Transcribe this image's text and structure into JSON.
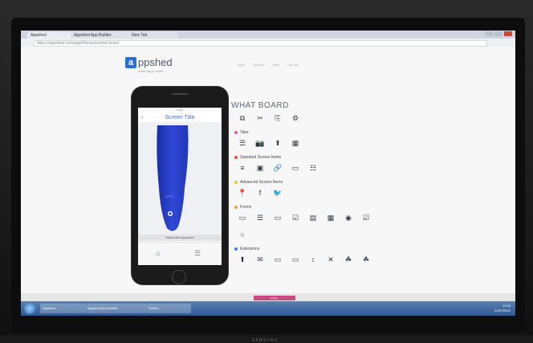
{
  "browser": {
    "tabs": [
      "Appshed",
      "Appshed App Builder",
      "New Tab"
    ],
    "url": "https://appshed.com/app/#/boards/what-board"
  },
  "page": {
    "logo_text": "ppshed",
    "logo_letter": "a",
    "logo_sub": "make apps online",
    "topnav": [
      "Apps",
      "Account",
      "Help",
      "Log out"
    ]
  },
  "phone": {
    "status": "9:41",
    "screen_title": "Screen Title",
    "back": "‹",
    "footer": "Made with Appshed",
    "tab_home": "⌂",
    "tab_list": "☰"
  },
  "panel": {
    "title": "WHAT BOARD",
    "subtitle": "",
    "top_icons": [
      {
        "icon": "⧉",
        "label": ""
      },
      {
        "icon": "✂",
        "label": ""
      },
      {
        "icon": "⎘",
        "label": ""
      },
      {
        "icon": "⚙",
        "label": ""
      }
    ],
    "sections": [
      {
        "label": "Tabs",
        "color": "#e05bb0",
        "icons": [
          "☰",
          "📷",
          "⬆",
          "▦"
        ]
      },
      {
        "label": "Standard Screen Items",
        "color": "#e2523f",
        "icons": [
          "≡",
          "▣",
          "🔗",
          "▭",
          "☷"
        ]
      },
      {
        "label": "Advanced Screen Items",
        "color": "#e8c62f",
        "icons": [
          "📍",
          "f",
          "🐦"
        ]
      },
      {
        "label": "Forms",
        "color": "#e8a12f",
        "icons": [
          "▭",
          "☰",
          "▭",
          "☑",
          "▤",
          "▦",
          "◉",
          "☑",
          "○"
        ]
      },
      {
        "label": "Extensions",
        "color": "#3a7de0",
        "icons": [
          "⬆",
          "✉",
          "▭",
          "▭",
          "↕",
          "✕",
          "☘",
          "☘"
        ]
      }
    ]
  },
  "taskbar": {
    "items": [
      "Appshed",
      "Appshed App Builder",
      "Screen"
    ],
    "clock": "12:05",
    "date": "01/07/2014"
  },
  "bottom": {
    "progress_label": "saving..."
  },
  "bezel": {
    "brand": "SAMSUNG"
  }
}
